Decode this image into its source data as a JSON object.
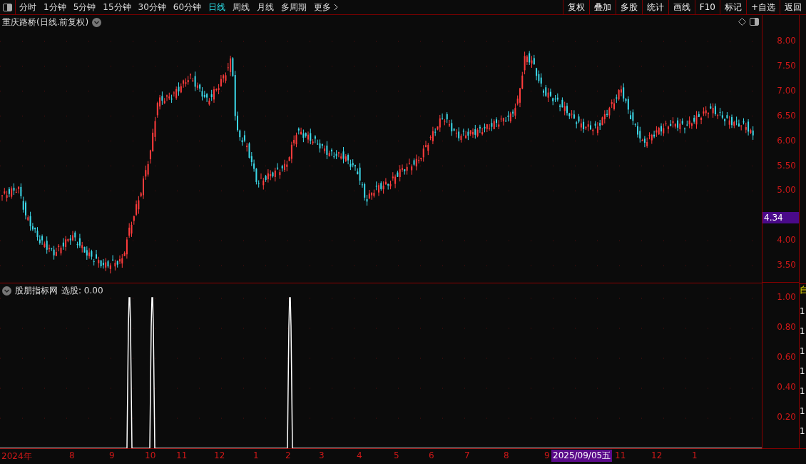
{
  "toolbar": {
    "periods": [
      {
        "label": "分时",
        "selected": false
      },
      {
        "label": "1分钟",
        "selected": false
      },
      {
        "label": "5分钟",
        "selected": false
      },
      {
        "label": "15分钟",
        "selected": false
      },
      {
        "label": "30分钟",
        "selected": false
      },
      {
        "label": "60分钟",
        "selected": false
      },
      {
        "label": "日线",
        "selected": true
      },
      {
        "label": "周线",
        "selected": false
      },
      {
        "label": "月线",
        "selected": false
      },
      {
        "label": "多周期",
        "selected": false
      },
      {
        "label": "更多",
        "selected": false
      }
    ],
    "actions": [
      "复权",
      "叠加",
      "多股",
      "统计",
      "画线",
      "F10",
      "标记",
      "+自选",
      "返回"
    ]
  },
  "main_chart": {
    "title": "重庆路桥(日线.前复权)",
    "price_ticks": [
      "8.00",
      "7.50",
      "7.00",
      "6.50",
      "6.00",
      "5.50",
      "5.00",
      "4.00",
      "3.50"
    ],
    "last_price": "4.34"
  },
  "indicator": {
    "name": "股朋指标网",
    "value_label": "选股: 0.00",
    "ticks": [
      "1.00",
      "0.80",
      "0.60",
      "0.40",
      "0.20"
    ]
  },
  "date_axis": {
    "labels": [
      {
        "text": "2024年",
        "kind": "label"
      },
      {
        "text": "8",
        "kind": "label"
      },
      {
        "text": "9",
        "kind": "label"
      },
      {
        "text": "10",
        "kind": "label"
      },
      {
        "text": "11",
        "kind": "label"
      },
      {
        "text": "12",
        "kind": "label"
      },
      {
        "text": "1",
        "kind": "label"
      },
      {
        "text": "2",
        "kind": "label"
      },
      {
        "text": "3",
        "kind": "label"
      },
      {
        "text": "4",
        "kind": "label"
      },
      {
        "text": "5",
        "kind": "label"
      },
      {
        "text": "6",
        "kind": "label"
      },
      {
        "text": "7",
        "kind": "label"
      },
      {
        "text": "8",
        "kind": "label"
      },
      {
        "text": "9",
        "kind": "label"
      },
      {
        "text": "2025/09/05五",
        "kind": "cursor"
      },
      {
        "text": "11",
        "kind": "label"
      },
      {
        "text": "12",
        "kind": "label"
      },
      {
        "text": "1",
        "kind": "label"
      }
    ]
  },
  "side_strip": {
    "header": "自",
    "values": [
      "1",
      "1",
      "1",
      "1",
      "1",
      "1",
      "1"
    ]
  }
}
